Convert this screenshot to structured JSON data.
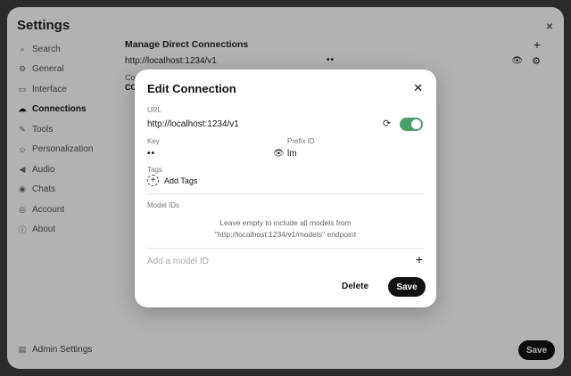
{
  "settings": {
    "title": "Settings",
    "close_icon": "×",
    "sidebar": [
      {
        "label": "Search",
        "icon": "search-icon",
        "glyph": "⌕"
      },
      {
        "label": "General",
        "icon": "gear-icon",
        "glyph": "⚙"
      },
      {
        "label": "Interface",
        "icon": "monitor-icon",
        "glyph": "▭"
      },
      {
        "label": "Connections",
        "icon": "cloud-icon",
        "glyph": "☁"
      },
      {
        "label": "Tools",
        "icon": "wrench-icon",
        "glyph": "✎"
      },
      {
        "label": "Personalization",
        "icon": "person-icon",
        "glyph": "☺"
      },
      {
        "label": "Audio",
        "icon": "speaker-icon",
        "glyph": "◀"
      },
      {
        "label": "Chats",
        "icon": "chat-icon",
        "glyph": "◉"
      },
      {
        "label": "Account",
        "icon": "user-circle-icon",
        "glyph": "◎"
      },
      {
        "label": "About",
        "icon": "info-icon",
        "glyph": "ⓘ"
      }
    ],
    "active_item": "Connections",
    "admin_settings": {
      "label": "Admin Settings",
      "icon": "admin-icon",
      "glyph": "▤"
    },
    "main": {
      "heading": "Manage Direct Connections",
      "plus": "+",
      "connection_url": "http://localhost:1234/v1",
      "connection_key_mask": "••",
      "partial_line_1": "Co",
      "partial_line_2": "CO"
    },
    "save_label": "Save"
  },
  "modal": {
    "title": "Edit Connection",
    "close_icon": "✕",
    "url_label": "URL",
    "url_value": "http://localhost:1234/v1",
    "refresh_icon": "⟳",
    "enabled": true,
    "accent_color": "#48a06a",
    "key_label": "Key",
    "key_mask": "••",
    "eye_icon": "👁",
    "prefix_label": "Prefix ID",
    "prefix_value": "lm",
    "tags_label": "Tags",
    "add_tags_label": "Add Tags",
    "model_ids_label": "Model IDs",
    "model_ids_helper": "Leave empty to include all models from \"http://localhost:1234/v1/models\" endpoint",
    "model_input_placeholder": "Add a model ID",
    "model_add": "+",
    "delete_label": "Delete",
    "save_label": "Save"
  }
}
